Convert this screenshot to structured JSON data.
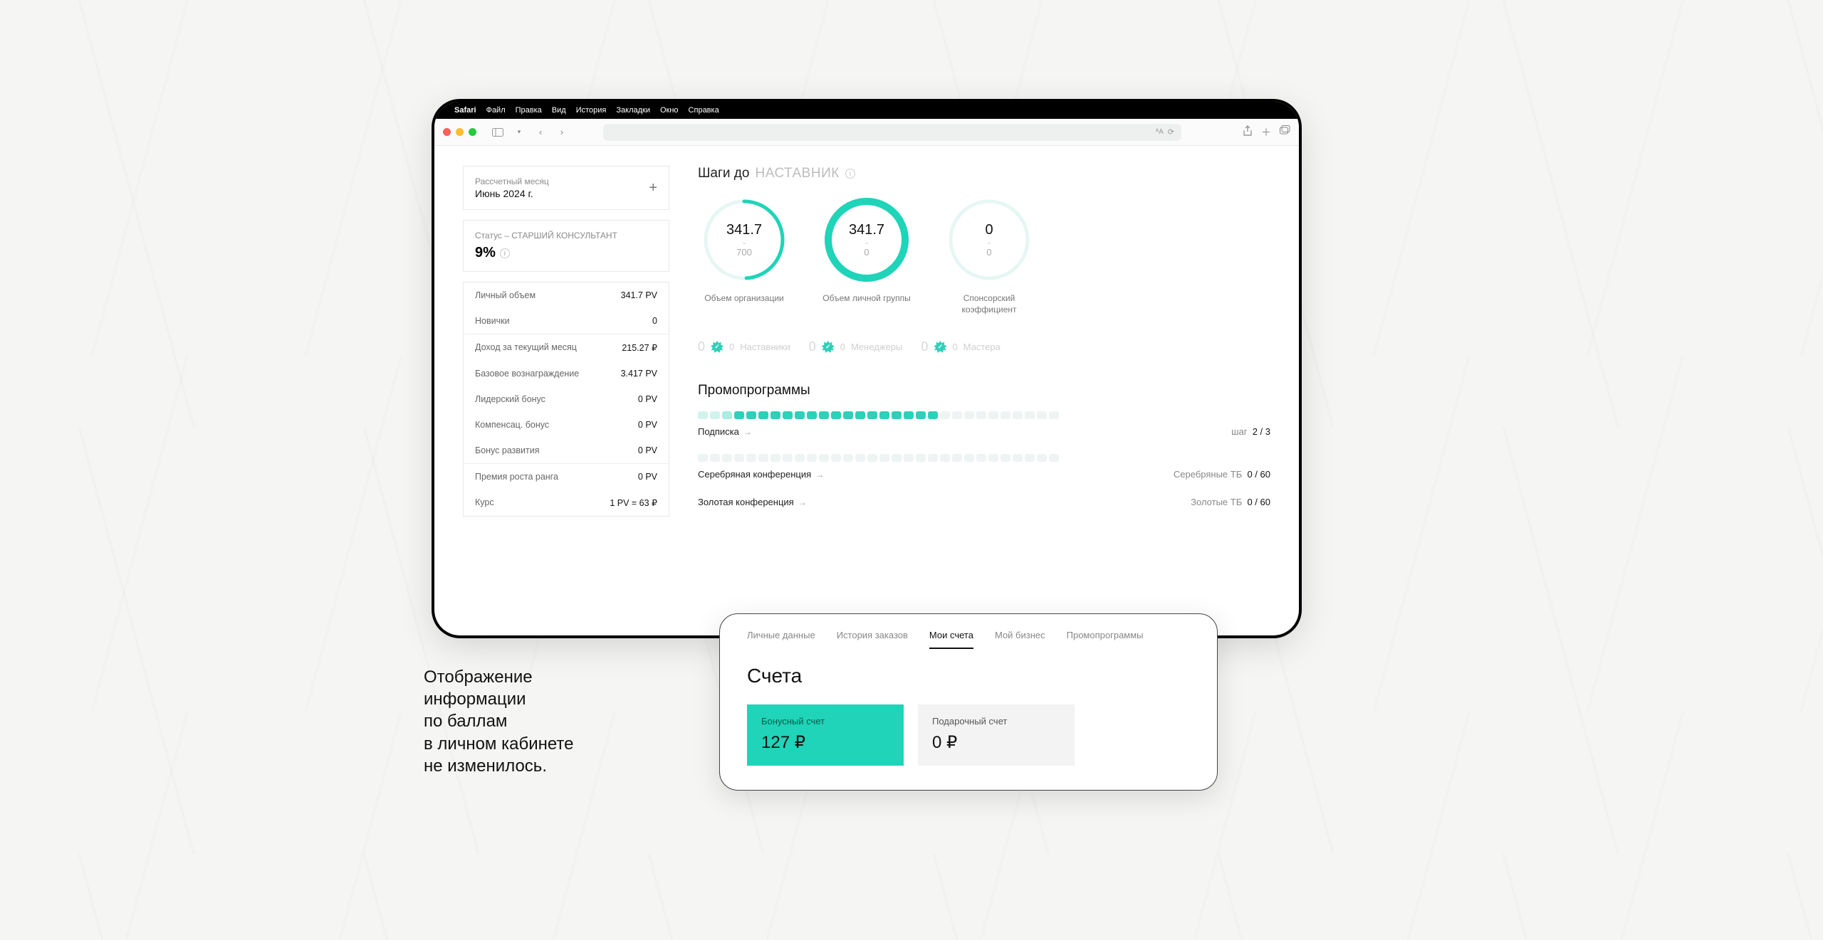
{
  "menubar": {
    "app": "Safari",
    "items": [
      "Файл",
      "Правка",
      "Вид",
      "История",
      "Закладки",
      "Окно",
      "Справка"
    ]
  },
  "sidebar": {
    "month": {
      "label": "Рассчетный месяц",
      "value": "Июнь 2024 г."
    },
    "status": {
      "line": "Статус – СТАРШИЙ КОНСУЛЬТАНТ",
      "pct": "9%"
    },
    "stats": [
      {
        "label": "Личный объем",
        "value": "341.7 PV",
        "sepBefore": false
      },
      {
        "label": "Новички",
        "value": "0",
        "sepBefore": false
      },
      {
        "label": "Доход за текущий месяц",
        "value": "215.27 ₽",
        "sepBefore": true
      },
      {
        "label": "Базовое вознаграждение",
        "value": "3.417 PV",
        "sepBefore": false
      },
      {
        "label": "Лидерский бонус",
        "value": "0 PV",
        "sepBefore": false
      },
      {
        "label": "Компенсац. бонус",
        "value": "0 PV",
        "sepBefore": false
      },
      {
        "label": "Бонус развития",
        "value": "0 PV",
        "sepBefore": false
      },
      {
        "label": "Премия роста ранга",
        "value": "0 PV",
        "sepBefore": true
      },
      {
        "label": "Курс",
        "value": "1 PV = 63 ₽",
        "sepBefore": false
      }
    ]
  },
  "steps": {
    "prefix": "Шаги до",
    "target": "НАСТАВНИК",
    "rings": [
      {
        "num": "341.7",
        "den": "700",
        "label": "Объем организации",
        "pct": 49,
        "color": "#1fd4b8",
        "track": "#e6f7f3",
        "stroke": 5
      },
      {
        "num": "341.7",
        "den": "0",
        "label": "Объем личной группы",
        "pct": 100,
        "color": "#1fd4b8",
        "track": "#e6f7f3",
        "stroke": 10
      },
      {
        "num": "0",
        "den": "0",
        "label": "Спонсорский коэффициент",
        "pct": 0,
        "color": "#e6f7f3",
        "track": "#e6f7f3",
        "stroke": 5
      }
    ],
    "ranks": [
      {
        "zero": "0",
        "count": "0",
        "name": "Наставники"
      },
      {
        "zero": "0",
        "count": "0",
        "name": "Менеджеры"
      },
      {
        "zero": "0",
        "count": "0",
        "name": "Мастера"
      }
    ]
  },
  "promos": {
    "title": "Промопрограммы",
    "items": [
      {
        "name": "Подписка",
        "metaLabel": "шаг",
        "metaValue": "2 / 3",
        "filled": 20,
        "total": 30,
        "fade": true
      },
      {
        "name": "Серебряная конференция",
        "metaLabel": "Серебряные ТБ",
        "metaValue": "0 / 60",
        "filled": 0,
        "total": 30,
        "fade": false
      },
      {
        "name": "Золотая конференция",
        "metaLabel": "Золотые ТБ",
        "metaValue": "0 / 60",
        "filled": 0,
        "total": 30,
        "fade": false,
        "noBar": true
      }
    ]
  },
  "popup": {
    "tabs": [
      "Личные данные",
      "История заказов",
      "Мои счета",
      "Мой бизнес",
      "Промопрограммы"
    ],
    "activeTab": 2,
    "title": "Счета",
    "accounts": [
      {
        "label": "Бонусный счет",
        "value": "127 ₽",
        "active": true
      },
      {
        "label": "Подарочный счет",
        "value": "0 ₽",
        "active": false
      }
    ]
  },
  "caption": [
    "Отображение",
    "информации",
    "по баллам",
    "в личном кабинете",
    "не изменилось."
  ]
}
